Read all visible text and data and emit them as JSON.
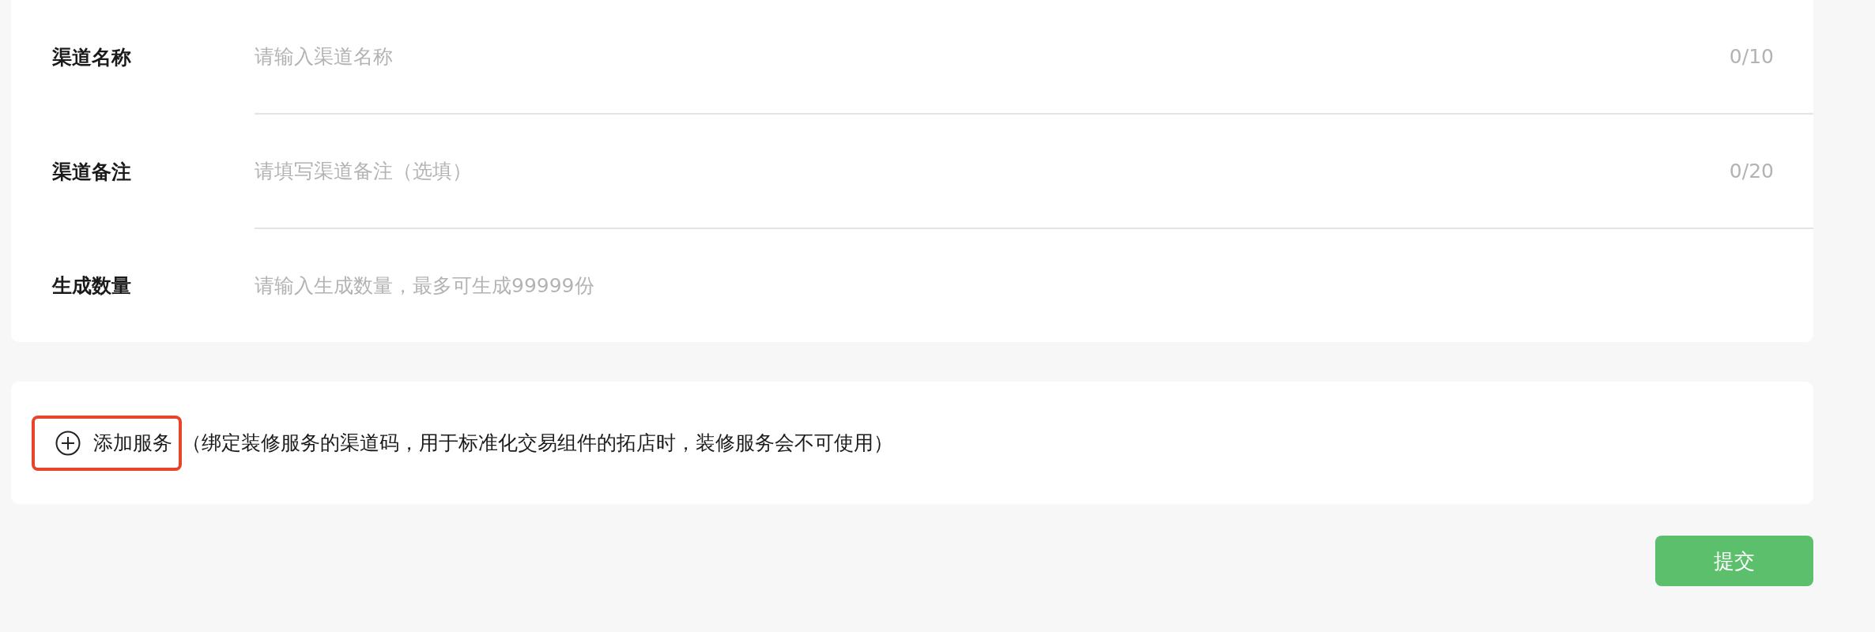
{
  "form": {
    "fields": [
      {
        "label": "渠道名称",
        "placeholder": "请输入渠道名称",
        "counter": "0/10"
      },
      {
        "label": "渠道备注",
        "placeholder": "请填写渠道备注（选填）",
        "counter": "0/20"
      },
      {
        "label": "生成数量",
        "placeholder": "请输入生成数量，最多可生成99999份"
      }
    ]
  },
  "add_service": {
    "label": "添加服务",
    "note": "（绑定装修服务的渠道码，用于标准化交易组件的拓店时，装修服务会不可使用）",
    "highlighted": true
  },
  "submit_button": "提交"
}
